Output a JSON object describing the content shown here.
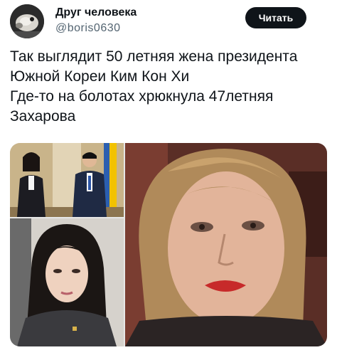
{
  "author": {
    "display_name": "Друг человека",
    "handle": "@boris0630",
    "avatar_icon": "avatar-cat-icon"
  },
  "actions": {
    "follow_label": "Читать"
  },
  "tweet": {
    "lines": [
      "Так выглядит 50 летняя жена президента",
      "Южной Кореи Ким Кон Хи",
      "Где-то на болотах хрюкнула 47летняя",
      "Захарова"
    ]
  },
  "media": {
    "photo_count": 3
  },
  "colors": {
    "text": "#0f1419",
    "secondary": "#536471",
    "button_bg": "#0f1419"
  }
}
